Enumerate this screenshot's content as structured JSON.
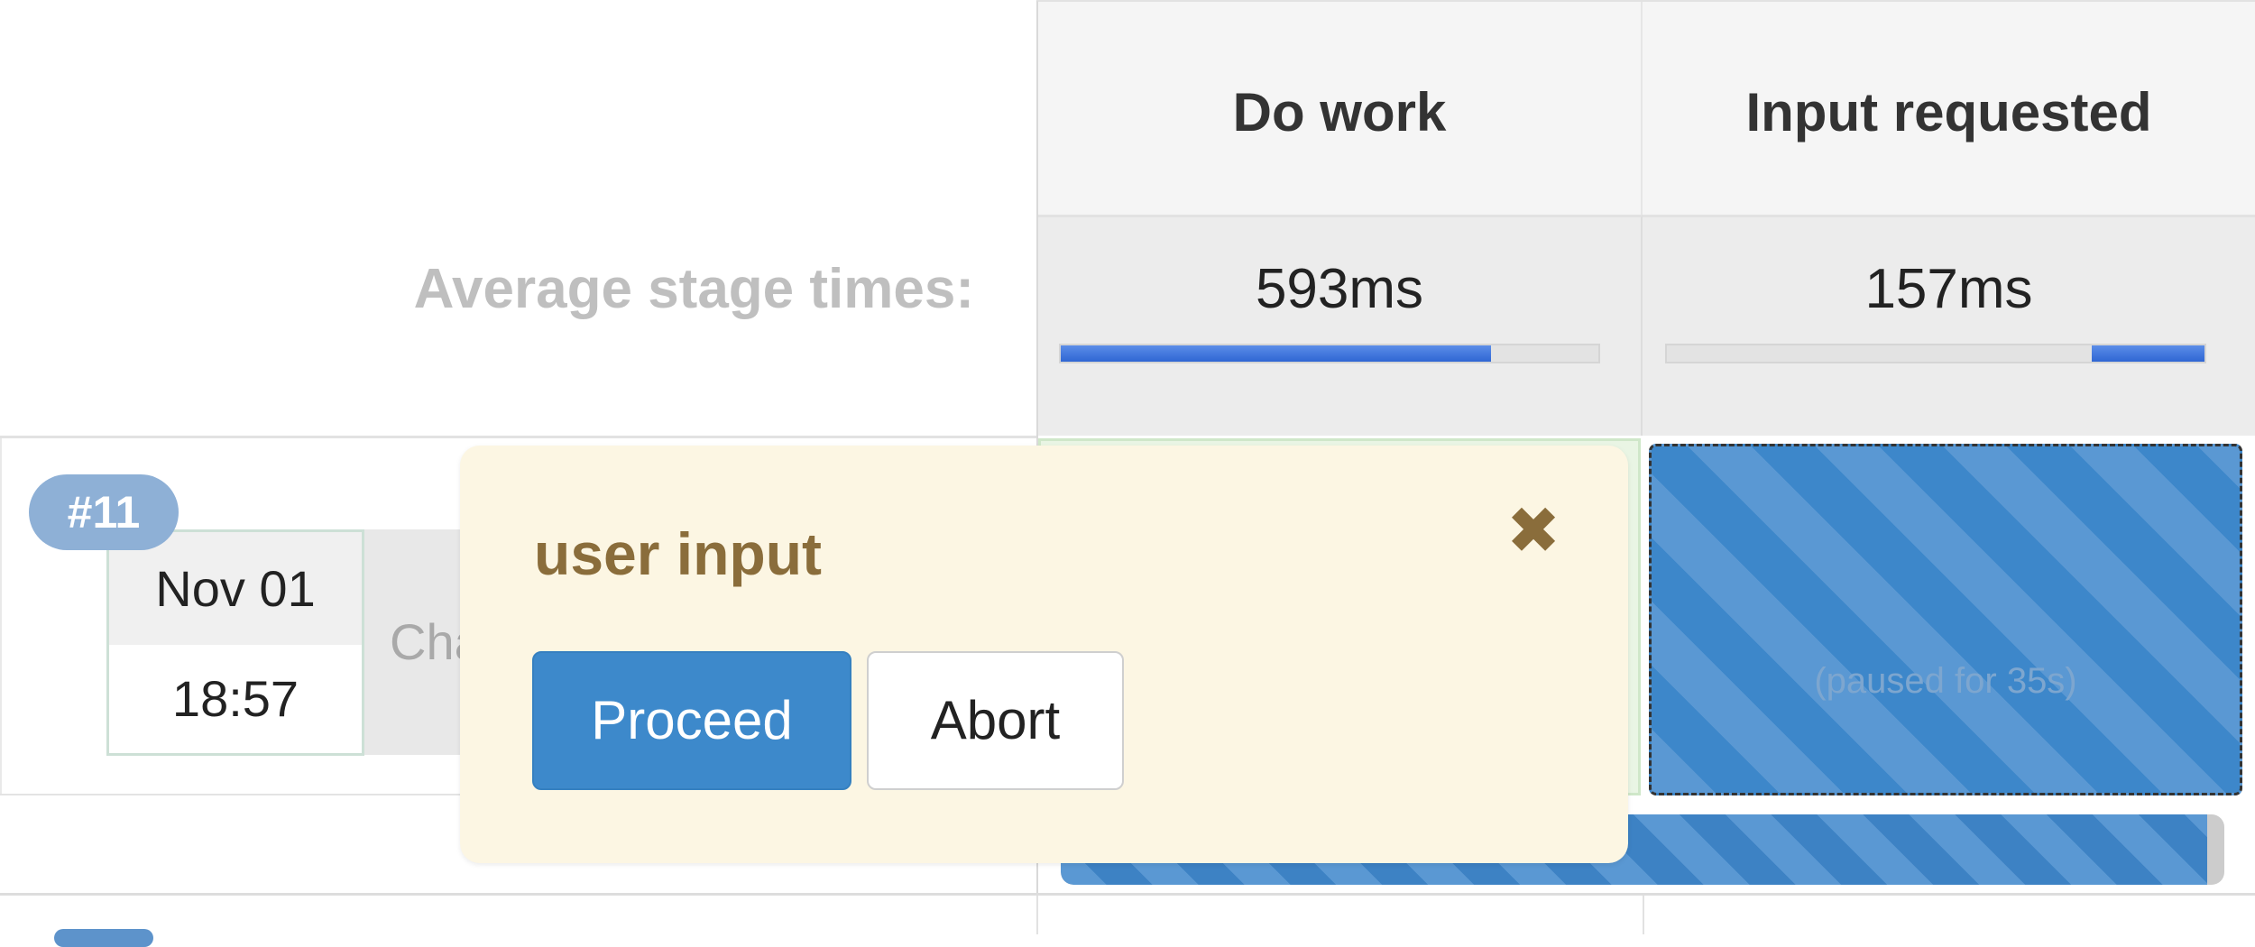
{
  "stages": [
    {
      "name": "Do work",
      "avg_time": "593ms",
      "avg_share": 0.8
    },
    {
      "name": "Input requested",
      "avg_time": "157ms",
      "avg_share": 0.21
    }
  ],
  "average_label": "Average stage times:",
  "run": {
    "number": "#11",
    "date": "Nov 01",
    "time": "18:57",
    "changes_label": "Cha",
    "paused_text": "(paused for 35s)",
    "progress": 0.985
  },
  "popover": {
    "title": "user input",
    "proceed_label": "Proceed",
    "abort_label": "Abort",
    "close_icon": "close-icon"
  },
  "colors": {
    "success_cell": "#e9f5e4",
    "paused_blue": "#3d87ca",
    "popover_bg": "#fcf6e3",
    "popover_text": "#8a6d3b",
    "badge": "#8eb0d6"
  }
}
